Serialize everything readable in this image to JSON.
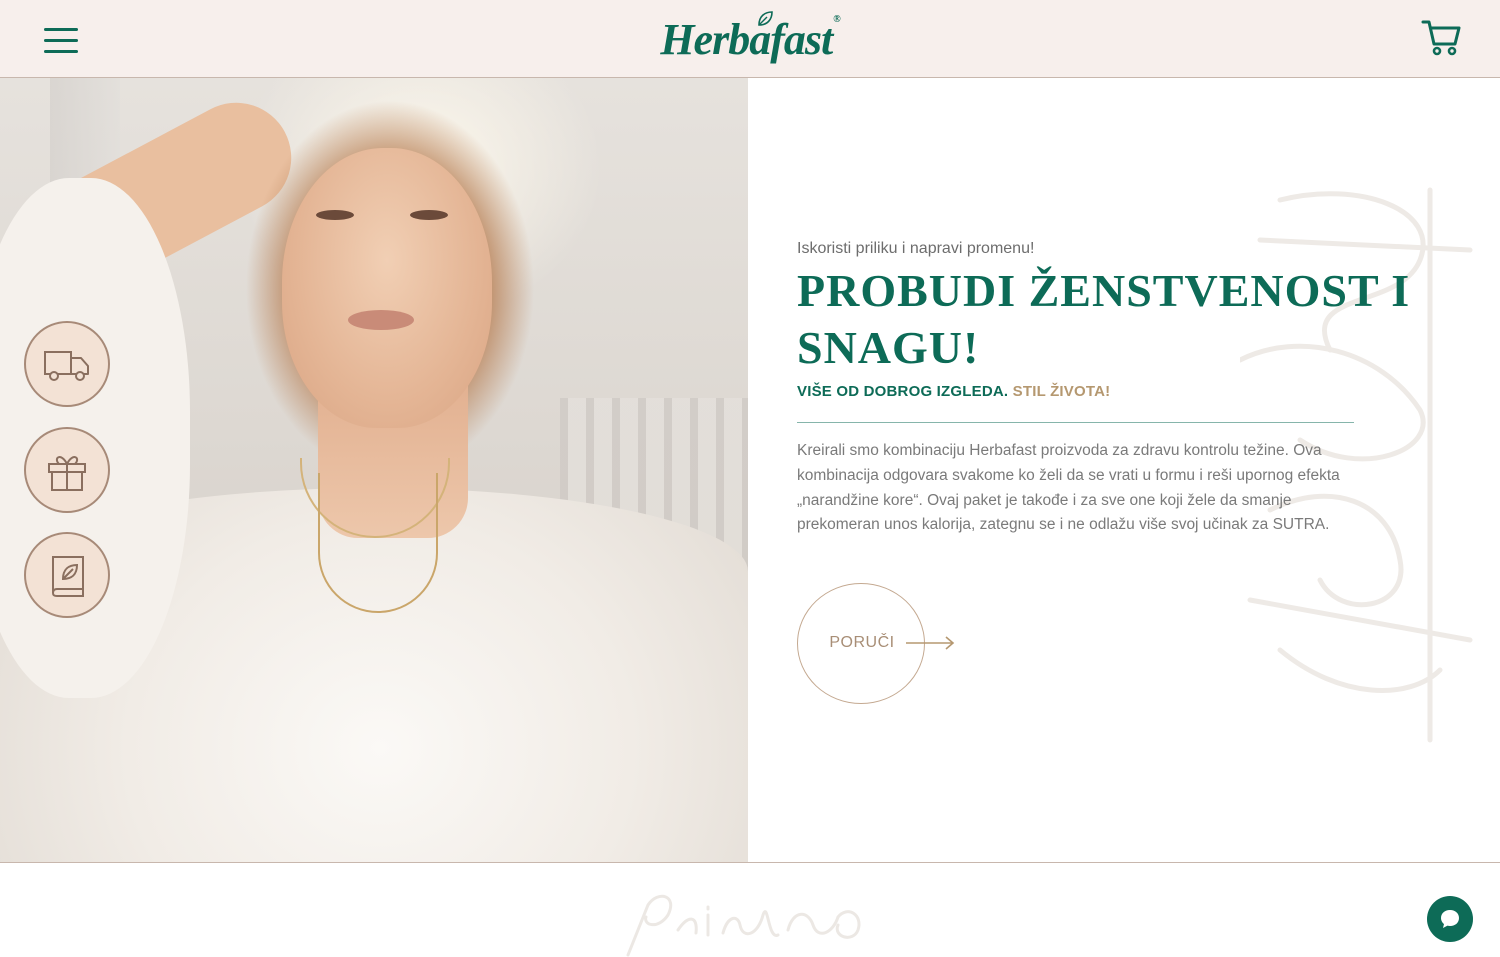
{
  "header": {
    "logo_text": "Herbafast",
    "logo_reg": "®",
    "menu_icon": "hamburger-menu-icon",
    "cart_icon": "shopping-cart-icon"
  },
  "features": [
    {
      "icon": "delivery-truck-icon"
    },
    {
      "icon": "gift-icon"
    },
    {
      "icon": "book-leaf-icon"
    }
  ],
  "hero": {
    "eyebrow": "Iskoristi priliku i napravi promenu!",
    "headline": "PROBUDI ŽENSTVENOST I SNAGU!",
    "subline_main": "VIŠE OD DOBROG IZGLEDA.",
    "subline_accent": "STIL ŽIVOTA!",
    "body": "Kreirali smo kombinaciju Herbafast proizvoda za zdravu kontrolu težine. Ova kombinacija odgovara svakome ko želi da se vrati u formu i reši upornog efekta „narandžine kore“. Ovaj paket je takođe i za sve one koji žele da smanje prekomeran unos kalorija, zategnu se i ne odlažu više svoj učinak za SUTRA.",
    "order_label": "PORUČI"
  },
  "decor": {
    "script_side": "Stil života",
    "script_bottom": "prirodno"
  },
  "chat": {
    "icon": "chat-bubble-icon"
  },
  "colors": {
    "brand_green": "#0d6b57",
    "accent_gold": "#b59870",
    "header_bg": "#f7efec",
    "feature_bg": "#f3e2d5"
  }
}
